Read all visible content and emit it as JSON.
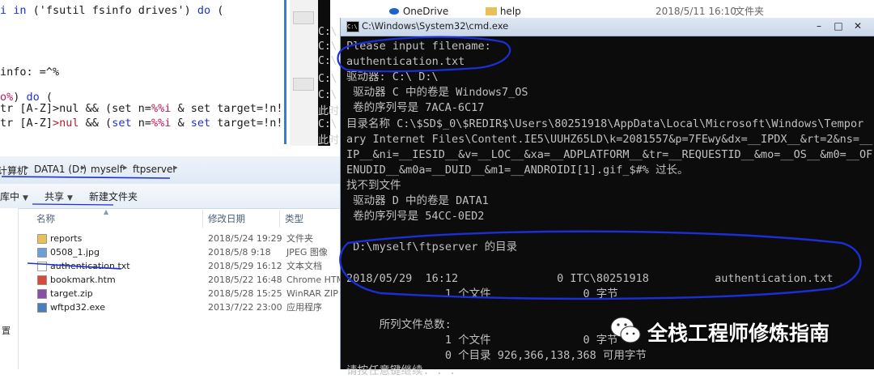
{
  "editor": {
    "lines": [
      {
        "parts": [
          [
            "kw",
            "i "
          ],
          [
            "kw",
            "in"
          ],
          [
            "str",
            " ('fsutil fsinfo drives') "
          ],
          [
            "kw",
            "do"
          ],
          [
            "str",
            " ("
          ]
        ]
      },
      {
        "parts": [
          [
            "str",
            "info: =^%"
          ]
        ]
      },
      {
        "parts": [
          [
            "pct",
            "o%"
          ],
          [
            "str",
            ") "
          ],
          [
            "kw",
            "do"
          ],
          [
            "str",
            " ("
          ]
        ]
      },
      {
        "parts": [
          [
            "str",
            "tr [A-Z]>nul && (set n="
          ],
          [
            "pct",
            "%%i"
          ],
          [
            "str",
            " & set target=!n!"
          ]
        ]
      },
      {
        "parts": [
          [
            "str",
            "tr [A-Z]"
          ],
          [
            "op",
            ">nul"
          ],
          [
            "str",
            " && ("
          ],
          [
            "kw",
            "set"
          ],
          [
            "str",
            " n="
          ],
          [
            "pct",
            "%%i"
          ],
          [
            "str",
            " & "
          ],
          [
            "kw",
            "set"
          ],
          [
            "str",
            " target=!n!"
          ]
        ]
      }
    ]
  },
  "bg_console": {
    "lines": [
      "C:\\",
      "C:\\",
      "C:\\",
      "C:\\",
      "C:\\",
      "此时",
      "C:\\",
      "此时"
    ]
  },
  "top_strip": {
    "onedrive_label": "OneDrive",
    "help_label": "help",
    "help_date": "2018/5/11 16:10",
    "help_type": "文件夹"
  },
  "explorer": {
    "breadcrumb": [
      "计算机",
      "DATA1 (D:)",
      "myself",
      "ftpserver"
    ],
    "toolbar": {
      "library": "库中",
      "share": "共享",
      "new_folder": "新建文件夹"
    },
    "nav_label": "置",
    "columns": {
      "name": "名称",
      "modified": "修改日期",
      "type": "类型"
    },
    "files": [
      {
        "name": "reports",
        "date": "2018/5/24 19:29",
        "type": "文件夹",
        "icon": "folder-icon"
      },
      {
        "name": "0508_1.jpg",
        "date": "2018/5/8 9:18",
        "type": "JPEG 图像",
        "icon": "image-icon"
      },
      {
        "name": "authentication.txt",
        "date": "2018/5/29 16:12",
        "type": "文本文档",
        "icon": "text-file-icon"
      },
      {
        "name": "bookmark.htm",
        "date": "2018/5/22 16:48",
        "type": "Chrome HTML",
        "icon": "chrome-icon"
      },
      {
        "name": "target.zip",
        "date": "2018/5/28 15:25",
        "type": "WinRAR ZIP 压",
        "icon": "zip-icon"
      },
      {
        "name": "wftpd32.exe",
        "date": "2013/7/22 23:00",
        "type": "应用程序",
        "icon": "exe-icon"
      }
    ]
  },
  "cmd": {
    "title": "C:\\Windows\\System32\\cmd.exe",
    "lines": [
      "Please input filename:",
      "authentication.txt",
      "驱动器: C:\\ D:\\",
      " 驱动器 C 中的卷是 Windows7_OS",
      " 卷的序列号是 7ACA-6C17",
      "目录名称 C:\\$SD$_0\\$REDIR$\\Users\\80251918\\AppData\\Local\\Microsoft\\Windows\\Tempor",
      "ary Internet Files\\Content.IE5\\UUHZ65LD\\k=2081557&p=7FEwy&dx=__IPDX__&rt=2&ns=__",
      "IP__&ni=__IESID__&v=__LOC__&xa=__ADPLATFORM__&tr=__REQUESTID__&mo=__OS__&m0=__OF",
      "ENUDID__&m0a=__DUID__&m1=__ANDROIDI[1].gif_$#% 过长。",
      "找不到文件",
      " 驱动器 D 中的卷是 DATA1",
      " 卷的序列号是 54CC-0ED2",
      "",
      " D:\\myself\\ftpserver 的目录",
      "",
      "2018/05/29  16:12               0 ITC\\80251918          authentication.txt",
      "               1 个文件              0 字节",
      "",
      "     所列文件总数:",
      "               1 个文件              0 字节",
      "               0 个目录 926,366,138,368 可用字节",
      "请按任意键继续. . ."
    ]
  },
  "watermark": {
    "text": "全栈工程师修炼指南",
    "icon": "wechat-icon"
  },
  "colors": {
    "annotation": "#1a2fd6",
    "cmd_bg": "#0c0c0c",
    "cmd_text": "#c0c0c0"
  }
}
